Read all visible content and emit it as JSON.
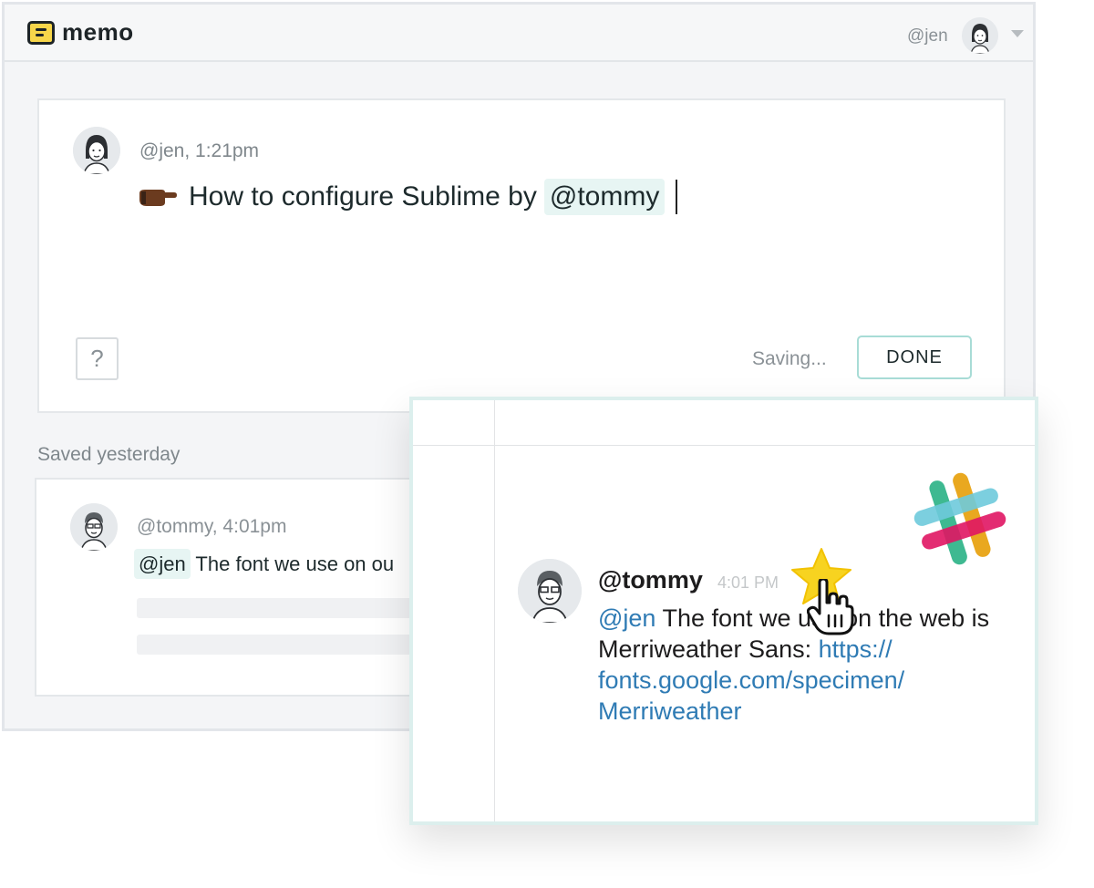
{
  "app": {
    "logo_text": "memo",
    "current_user": "@jen"
  },
  "editor": {
    "meta": "@jen, 1:21pm",
    "title_text": "How to configure Sublime by",
    "mention": "@tommy",
    "help_label": "?",
    "status": "Saving...",
    "done_label": "DONE"
  },
  "saved": {
    "section_label": "Saved yesterday",
    "meta": "@tommy, 4:01pm",
    "mention": "@jen",
    "text": "The font we use on ou"
  },
  "slack": {
    "author": "@tommy",
    "time": "4:01 PM",
    "mention": "@jen",
    "text_before": "The font we use on the web is Merriweather Sans:",
    "link_line1": "https://",
    "link_line2": "fonts.google.com/specimen/",
    "link_line3": "Merriweather"
  },
  "colors": {
    "accent_teal": "#a8dcd6",
    "logo_yellow": "#f7d64a",
    "link_blue": "#2f7bb4",
    "star_yellow": "#f7d320"
  },
  "icons": [
    "memo-logo-icon",
    "avatar-jen-icon",
    "chevron-down-icon",
    "pointing-hand-emoji-icon",
    "avatar-tommy-icon",
    "slack-logo-icon",
    "star-icon",
    "hand-cursor-icon"
  ]
}
